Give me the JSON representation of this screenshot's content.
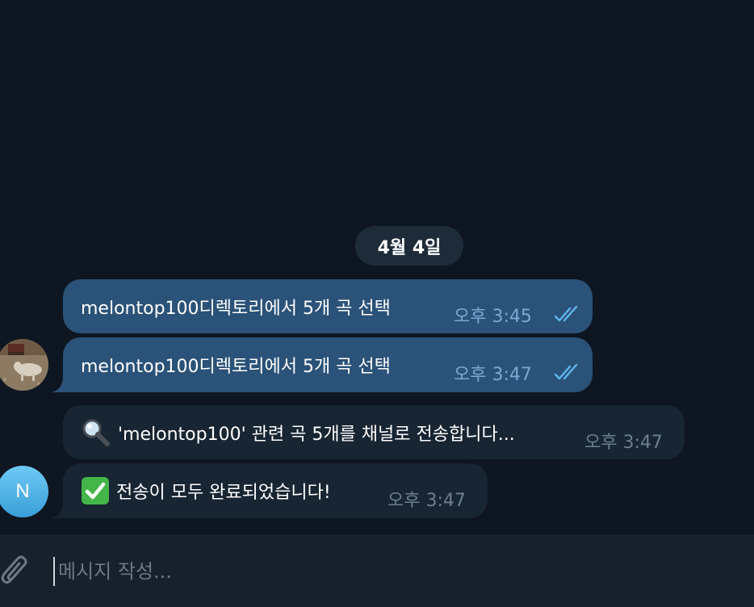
{
  "chat": {
    "date_separator": "4월 4일",
    "messages": [
      {
        "direction": "out",
        "text": "melontop100디렉토리에서 5개 곡 선택",
        "time": "오후 3:45",
        "status": "read"
      },
      {
        "direction": "out",
        "text": "melontop100디렉토리에서 5개 곡 선택",
        "time": "오후 3:47",
        "status": "read"
      },
      {
        "direction": "in",
        "icon": "magnifier-icon",
        "text": "'melontop100' 관련 곡 5개를 채널로 전송합니다...",
        "time": "오후 3:47"
      },
      {
        "direction": "in",
        "icon": "check-mark-button-icon",
        "text": "전송이 모두 완료되었습니다!",
        "time": "오후 3:47"
      }
    ],
    "avatars": {
      "outgoing": "dog-photo",
      "incoming_initial": "N"
    }
  },
  "composer": {
    "placeholder": "메시지 작성..."
  },
  "colors": {
    "background": "#0e1621",
    "outgoing_bubble": "#2b5278",
    "incoming_bubble": "#182533",
    "date_pill": "#1e2c3a",
    "read_check": "#5fb6ef",
    "composer": "#17212b"
  }
}
